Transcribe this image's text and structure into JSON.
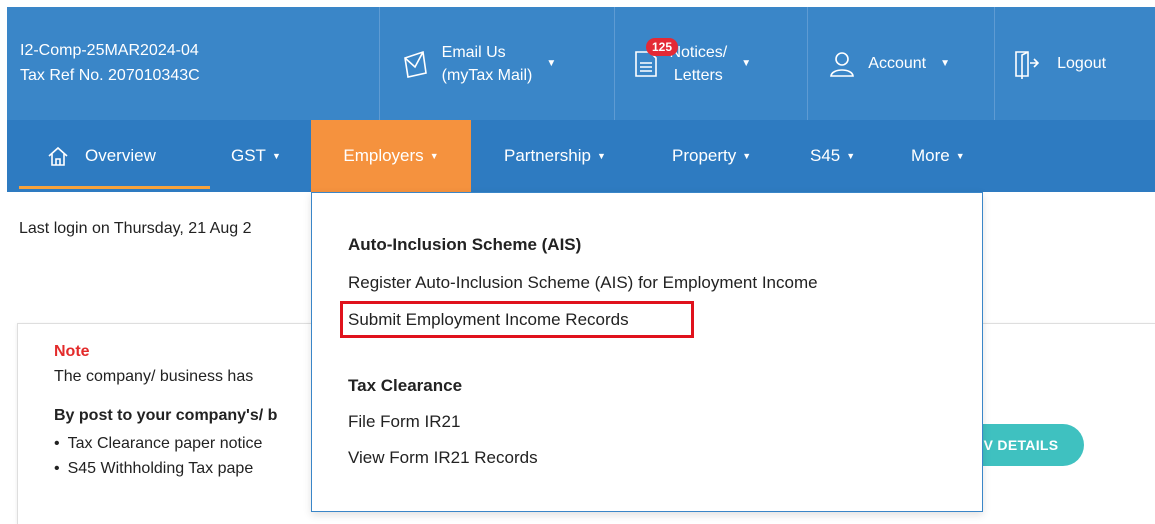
{
  "entity": {
    "name": "I2-Comp-25MAR2024-04",
    "tax_ref": "Tax Ref No. 207010343C"
  },
  "topbar": {
    "email": {
      "line1": "Email Us",
      "line2": "(myTax Mail)",
      "icon": "envelope-icon"
    },
    "notices": {
      "line1": "Notices/",
      "line2": "Letters",
      "badge": "125",
      "icon": "document-icon"
    },
    "account": {
      "label": "Account",
      "icon": "user-icon"
    },
    "logout": {
      "label": "Logout",
      "icon": "logout-icon"
    }
  },
  "nav": {
    "overview": "Overview",
    "gst": "GST",
    "employers": "Employers",
    "partnership": "Partnership",
    "property": "Property",
    "s45": "S45",
    "more": "More",
    "active_color": "#f5923e"
  },
  "last_login": "Last login on Thursday, 21 Aug 2",
  "note": {
    "title": "Note",
    "text": "The company/ business has",
    "bold": "By post to your company's/ b",
    "items": [
      "Tax Clearance paper notice",
      "S45 Withholding Tax pape"
    ],
    "button": "V DETAILS"
  },
  "dropdown": {
    "ais_heading": "Auto-Inclusion Scheme (AIS)",
    "ais_register": "Register Auto-Inclusion Scheme (AIS) for Employment Income",
    "ais_submit": "Submit Employment Income Records",
    "tc_heading": "Tax Clearance",
    "tc_file": "File Form IR21",
    "tc_view": "View Form IR21 Records"
  },
  "colors": {
    "primary": "#3a86c8",
    "nav": "#2e7bc1",
    "accent": "#f5923e",
    "highlight": "#e0121c",
    "badge": "#e42935",
    "button": "#3fc1c0"
  }
}
